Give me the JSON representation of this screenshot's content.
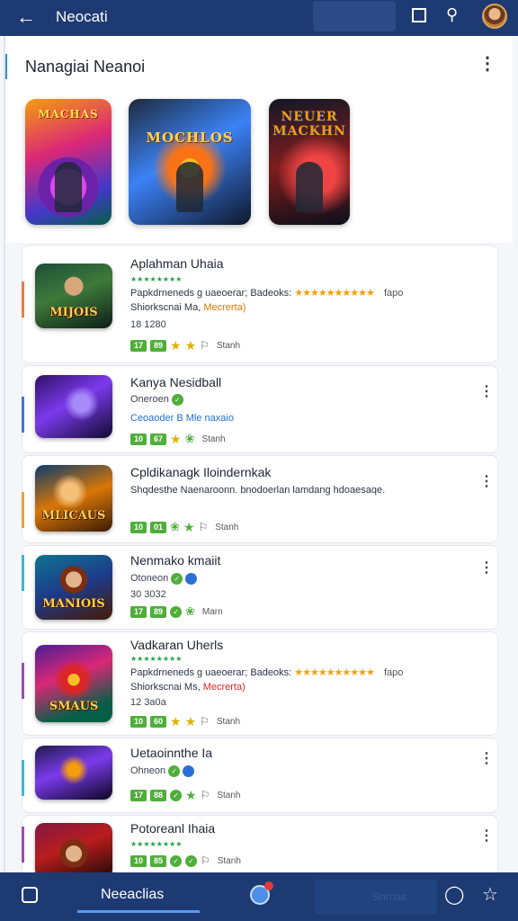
{
  "topbar": {
    "title": "Neocati",
    "back_icon": "arrow-left-icon"
  },
  "header": {
    "title": "Nanagiai Neanoi"
  },
  "featured": [
    {
      "label": "MACHAS"
    },
    {
      "label": "MOCHLOS"
    },
    {
      "label": "NEUER\nMACKHN"
    }
  ],
  "cards": [
    {
      "name": "Aplahman Uhaia",
      "stars": "★★★★★★★★",
      "desc": "Papkdrneneds g uaeoerar; Badeoks:",
      "rating_bar": "★★★★★★★★★★",
      "tag_tail": "fapo",
      "desc2_a": "Shiorkscnai Ma,",
      "desc2_hl": "Mecrerta)",
      "meta": "18 1280",
      "thumb_label": "MIJOIS",
      "badge1": "17",
      "badge2": "89",
      "right_label": "Stanh"
    },
    {
      "name": "Kanya Nesidball",
      "meta": "Oneroen",
      "desc": "Ceoaoder B Mle naxaio",
      "thumb_label": "",
      "badge1": "10",
      "badge2": "67",
      "right_label": "Stanh"
    },
    {
      "name": "Cpldikanagk Iloindernkak",
      "desc": "Shqdesthe Naenaroonn. bnodoerlan lamdang hdoaesaqe.",
      "thumb_label": "MLICAUS",
      "badge1": "10",
      "badge2": "01",
      "right_label": "Stanh"
    },
    {
      "name": "Nenmako kmaiit",
      "meta": "Otoneon",
      "meta2": "30 3032",
      "thumb_label": "MANIOIS",
      "badge1": "17",
      "badge2": "89",
      "right_label": "Marn"
    },
    {
      "name": "Vadkaran Uherls",
      "stars": "★★★★★★★★",
      "desc": "Papkdrneneds g uaeoerar; Badeoks:",
      "rating_bar": "★★★★★★★★★★",
      "tag_tail": "fapo",
      "desc2_a": "Shiorkscnai Ms,",
      "desc2_hl": "Mecrerta)",
      "meta": "12 3a0a",
      "thumb_label": "SMAUS",
      "badge1": "10",
      "badge2": "60",
      "right_label": "Stanh"
    },
    {
      "name": "Uetaoinnthe Ia",
      "meta": "Ohneon",
      "thumb_label": "",
      "badge1": "17",
      "badge2": "88",
      "right_label": "Stanh"
    },
    {
      "name": "Potoreanl Ihaia",
      "stars": "★★★★★★★★",
      "thumb_label": "",
      "badge1": "10",
      "badge2": "85",
      "right_label": "Stanh"
    }
  ],
  "bottombar": {
    "active_tab": "Neeaclias",
    "secondary": "Snrnas"
  },
  "colors": {
    "bar": "#1e3a72",
    "accent": "#4fae3a"
  }
}
